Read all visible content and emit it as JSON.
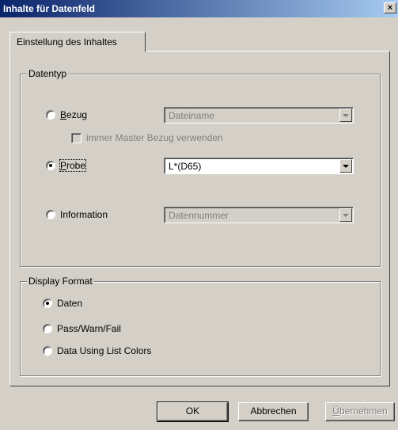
{
  "window": {
    "title": "Inhalte für Datenfeld",
    "close_label": "×"
  },
  "tabs": [
    {
      "label": "Einstellung des Inhaltes",
      "selected": true
    }
  ],
  "datentyp": {
    "group_title": "Datentyp",
    "bezug": {
      "label_underlined": "B",
      "label_rest": "ezug",
      "selected": false,
      "combo_value": "Dateiname",
      "combo_enabled": false
    },
    "master_checkbox": {
      "label": "immer Master Bezug verwenden",
      "checked": false,
      "enabled": false
    },
    "probe": {
      "label_underlined": "P",
      "label_rest": "robe",
      "selected": true,
      "combo_value": "L*(D65)",
      "combo_enabled": true
    },
    "information": {
      "label": "Information",
      "selected": false,
      "combo_value": "Datennummer",
      "combo_enabled": false
    }
  },
  "display_format": {
    "group_title": "Display Format",
    "options": [
      {
        "label": "Daten",
        "selected": true
      },
      {
        "label": "Pass/Warn/Fail",
        "selected": false
      },
      {
        "label": "Data Using List Colors",
        "selected": false
      }
    ]
  },
  "buttons": {
    "ok": "OK",
    "cancel": "Abbrechen",
    "apply_underlined": "Ü",
    "apply_rest": "bernehmen",
    "apply_enabled": false
  }
}
